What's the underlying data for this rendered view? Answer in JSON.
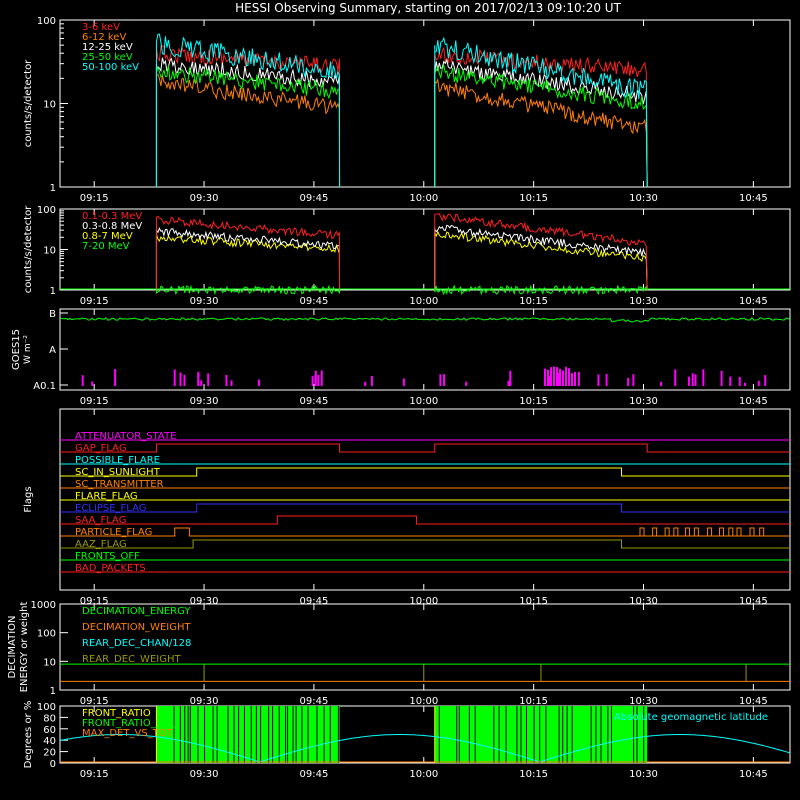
{
  "title": "HESSI Observing Summary, starting on 2017/02/13 09:10:20 UT",
  "time_ticks": [
    "09:15",
    "09:30",
    "09:45",
    "10:00",
    "10:15",
    "10:30",
    "10:45"
  ],
  "colors": {
    "red": "#ff2020",
    "orange": "#ff8000",
    "yellow": "#ffff00",
    "green": "#00ff00",
    "cyan": "#00ffff",
    "magenta": "#ff00ff",
    "blue": "#3030ff",
    "white": "#ffffff",
    "olive": "#999900",
    "brown": "#c0602a"
  },
  "chart_data": [
    {
      "type": "line",
      "panel": "counts-low",
      "ylabel": "counts/s/detector",
      "yscale": "log",
      "ylim": [
        1,
        100
      ],
      "y_ticks": [
        "1",
        "10",
        "100"
      ],
      "xlim": [
        "09:10:20",
        "10:50:00"
      ],
      "data_windows": [
        [
          "09:23:30",
          "09:48:30"
        ],
        [
          "10:01:30",
          "10:30:30"
        ]
      ],
      "series": [
        {
          "name": "3-6 keV",
          "color": "red",
          "start": [
            40,
            38
          ],
          "end": [
            28,
            25
          ]
        },
        {
          "name": "6-12 keV",
          "color": "orange",
          "start": [
            18,
            16
          ],
          "end": [
            9,
            5
          ]
        },
        {
          "name": "12-25 keV",
          "color": "white",
          "start": [
            30,
            28
          ],
          "end": [
            18,
            12
          ]
        },
        {
          "name": "25-50 keV",
          "color": "green",
          "start": [
            24,
            24
          ],
          "end": [
            14,
            10
          ]
        },
        {
          "name": "50-100 keV",
          "color": "cyan",
          "start": [
            52,
            50
          ],
          "end": [
            24,
            14
          ]
        }
      ]
    },
    {
      "type": "line",
      "panel": "counts-high",
      "ylabel": "counts/s/detector",
      "yscale": "log",
      "ylim": [
        1,
        100
      ],
      "y_ticks": [
        "1",
        "10",
        "100"
      ],
      "xlim": [
        "09:10:20",
        "10:50:00"
      ],
      "data_windows": [
        [
          "09:23:30",
          "09:48:30"
        ],
        [
          "10:01:30",
          "10:30:30"
        ]
      ],
      "series": [
        {
          "name": "0.1-0.3 MeV",
          "color": "red",
          "start": [
            55,
            70
          ],
          "end": [
            22,
            14
          ]
        },
        {
          "name": "0.3-0.8 MeV",
          "color": "white",
          "start": [
            28,
            35
          ],
          "end": [
            12,
            8
          ]
        },
        {
          "name": "0.8-7 MeV",
          "color": "yellow",
          "start": [
            20,
            25
          ],
          "end": [
            10,
            6
          ]
        },
        {
          "name": "7-20 MeV",
          "color": "green",
          "start": [
            1,
            1
          ],
          "end": [
            1,
            1
          ]
        }
      ]
    },
    {
      "type": "line",
      "panel": "goes",
      "ylabel": "GOES15",
      "yunit": "W m⁻²",
      "y_ticks": [
        "A0.1",
        "A",
        "B"
      ],
      "xlim": [
        "09:10:20",
        "10:50:00"
      ],
      "series": [
        {
          "name": "GOES flux",
          "color": "green",
          "level": "B"
        }
      ]
    },
    {
      "type": "line",
      "panel": "flags",
      "ylabel": "Flags",
      "xlim": [
        "09:10:20",
        "10:50:00"
      ],
      "series": [
        {
          "name": "ATTENUATOR_STATE",
          "color": "magenta",
          "transitions": []
        },
        {
          "name": "GAP_FLAG",
          "color": "red",
          "transitions": [
            "09:23:30",
            "09:48:30",
            "10:01:30",
            "10:30:30"
          ]
        },
        {
          "name": "POSSIBLE_FLARE",
          "color": "cyan",
          "transitions": []
        },
        {
          "name": "SC_IN_SUNLIGHT",
          "color": "yellow",
          "transitions": [
            "09:29:00",
            "10:27:00"
          ]
        },
        {
          "name": "SC_TRANSMITTER",
          "color": "orange",
          "transitions": []
        },
        {
          "name": "FLARE_FLAG",
          "color": "yellow",
          "transitions": []
        },
        {
          "name": "ECLIPSE_FLAG",
          "color": "blue",
          "transitions": [
            "09:29:00",
            "10:27:00"
          ]
        },
        {
          "name": "SAA_FLAG",
          "color": "red",
          "transitions": [
            "09:40:00",
            "09:59:00"
          ]
        },
        {
          "name": "PARTICLE_FLAG",
          "color": "orange",
          "transitions": [
            "09:26:00",
            "09:28:00"
          ]
        },
        {
          "name": "AAZ_FLAG",
          "color": "olive",
          "transitions": [
            "09:28:30",
            "10:27:00"
          ]
        },
        {
          "name": "FRONTS_OFF",
          "color": "green",
          "transitions": []
        },
        {
          "name": "BAD_PACKETS",
          "color": "red",
          "transitions": []
        }
      ]
    },
    {
      "type": "line",
      "panel": "decimation",
      "ylabel": "DECIMATION ENERGY or weight",
      "yscale": "log",
      "ylim": [
        1,
        1000
      ],
      "y_ticks": [
        "1",
        "10",
        "100",
        "1000"
      ],
      "xlim": [
        "09:10:20",
        "10:50:00"
      ],
      "series": [
        {
          "name": "DECIMATION_ENERGY",
          "color": "green"
        },
        {
          "name": "DECIMATION_WEIGHT",
          "color": "orange"
        },
        {
          "name": "REAR_DEC_CHAN/128",
          "color": "cyan"
        },
        {
          "name": "REAR_DEC_WEIGHT",
          "color": "olive"
        }
      ]
    },
    {
      "type": "line",
      "panel": "ratios",
      "ylabel": "Degrees or %",
      "ylim": [
        0,
        100
      ],
      "y_ticks": [
        "0",
        "20",
        "40",
        "60",
        "80",
        "100"
      ],
      "xlim": [
        "09:10:20",
        "10:50:00"
      ],
      "series": [
        {
          "name": "FRONT_RATIO",
          "color": "yellow"
        },
        {
          "name": "FRONT_RATIO_____",
          "color": "green"
        },
        {
          "name": "MAX_DET_VS_TOT",
          "color": "orange"
        },
        {
          "name": "Absolute geomagnetic latitude",
          "color": "cyan"
        }
      ]
    }
  ]
}
